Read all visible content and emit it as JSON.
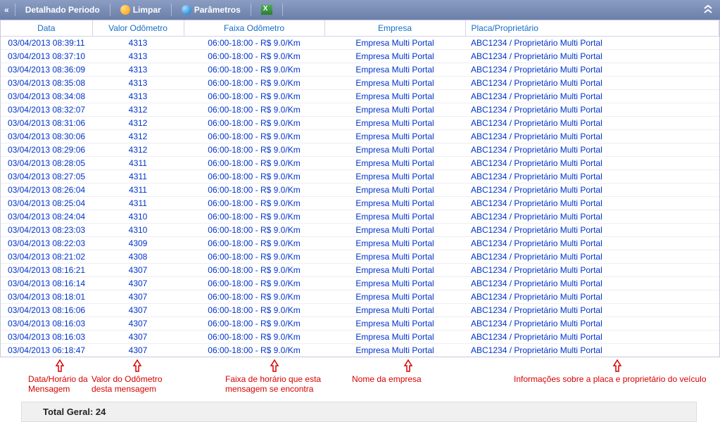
{
  "toolbar": {
    "detalhado": "Detalhado Periodo",
    "limpar": "Limpar",
    "parametros": "Parâmetros"
  },
  "columns": {
    "data": "Data",
    "valor": "Valor Odômetro",
    "faixa": "Faixa Odômetro",
    "empresa": "Empresa",
    "placa": "Placa/Proprietário"
  },
  "rows": [
    {
      "data": "03/04/2013 08:39:11",
      "valor": "4313",
      "faixa": "06:00-18:00 - R$ 9.0/Km",
      "empresa": "Empresa Multi Portal",
      "placa": "ABC1234 / Proprietário Multi Portal"
    },
    {
      "data": "03/04/2013 08:37:10",
      "valor": "4313",
      "faixa": "06:00-18:00 - R$ 9.0/Km",
      "empresa": "Empresa Multi Portal",
      "placa": "ABC1234 / Proprietário Multi Portal"
    },
    {
      "data": "03/04/2013 08:36:09",
      "valor": "4313",
      "faixa": "06:00-18:00 - R$ 9.0/Km",
      "empresa": "Empresa Multi Portal",
      "placa": "ABC1234 / Proprietário Multi Portal"
    },
    {
      "data": "03/04/2013 08:35:08",
      "valor": "4313",
      "faixa": "06:00-18:00 - R$ 9.0/Km",
      "empresa": "Empresa Multi Portal",
      "placa": "ABC1234 / Proprietário Multi Portal"
    },
    {
      "data": "03/04/2013 08:34:08",
      "valor": "4313",
      "faixa": "06:00-18:00 - R$ 9.0/Km",
      "empresa": "Empresa Multi Portal",
      "placa": "ABC1234 / Proprietário Multi Portal"
    },
    {
      "data": "03/04/2013 08:32:07",
      "valor": "4312",
      "faixa": "06:00-18:00 - R$ 9.0/Km",
      "empresa": "Empresa Multi Portal",
      "placa": "ABC1234 / Proprietário Multi Portal"
    },
    {
      "data": "03/04/2013 08:31:06",
      "valor": "4312",
      "faixa": "06:00-18:00 - R$ 9.0/Km",
      "empresa": "Empresa Multi Portal",
      "placa": "ABC1234 / Proprietário Multi Portal"
    },
    {
      "data": "03/04/2013 08:30:06",
      "valor": "4312",
      "faixa": "06:00-18:00 - R$ 9.0/Km",
      "empresa": "Empresa Multi Portal",
      "placa": "ABC1234 / Proprietário Multi Portal"
    },
    {
      "data": "03/04/2013 08:29:06",
      "valor": "4312",
      "faixa": "06:00-18:00 - R$ 9.0/Km",
      "empresa": "Empresa Multi Portal",
      "placa": "ABC1234 / Proprietário Multi Portal"
    },
    {
      "data": "03/04/2013 08:28:05",
      "valor": "4311",
      "faixa": "06:00-18:00 - R$ 9.0/Km",
      "empresa": "Empresa Multi Portal",
      "placa": "ABC1234 / Proprietário Multi Portal"
    },
    {
      "data": "03/04/2013 08:27:05",
      "valor": "4311",
      "faixa": "06:00-18:00 - R$ 9.0/Km",
      "empresa": "Empresa Multi Portal",
      "placa": "ABC1234 / Proprietário Multi Portal"
    },
    {
      "data": "03/04/2013 08:26:04",
      "valor": "4311",
      "faixa": "06:00-18:00 - R$ 9.0/Km",
      "empresa": "Empresa Multi Portal",
      "placa": "ABC1234 / Proprietário Multi Portal"
    },
    {
      "data": "03/04/2013 08:25:04",
      "valor": "4311",
      "faixa": "06:00-18:00 - R$ 9.0/Km",
      "empresa": "Empresa Multi Portal",
      "placa": "ABC1234 / Proprietário Multi Portal"
    },
    {
      "data": "03/04/2013 08:24:04",
      "valor": "4310",
      "faixa": "06:00-18:00 - R$ 9.0/Km",
      "empresa": "Empresa Multi Portal",
      "placa": "ABC1234 / Proprietário Multi Portal"
    },
    {
      "data": "03/04/2013 08:23:03",
      "valor": "4310",
      "faixa": "06:00-18:00 - R$ 9.0/Km",
      "empresa": "Empresa Multi Portal",
      "placa": "ABC1234 / Proprietário Multi Portal"
    },
    {
      "data": "03/04/2013 08:22:03",
      "valor": "4309",
      "faixa": "06:00-18:00 - R$ 9.0/Km",
      "empresa": "Empresa Multi Portal",
      "placa": "ABC1234 / Proprietário Multi Portal"
    },
    {
      "data": "03/04/2013 08:21:02",
      "valor": "4308",
      "faixa": "06:00-18:00 - R$ 9.0/Km",
      "empresa": "Empresa Multi Portal",
      "placa": "ABC1234 / Proprietário Multi Portal"
    },
    {
      "data": "03/04/2013 08:16:21",
      "valor": "4307",
      "faixa": "06:00-18:00 - R$ 9.0/Km",
      "empresa": "Empresa Multi Portal",
      "placa": "ABC1234 / Proprietário Multi Portal"
    },
    {
      "data": "03/04/2013 08:16:14",
      "valor": "4307",
      "faixa": "06:00-18:00 - R$ 9.0/Km",
      "empresa": "Empresa Multi Portal",
      "placa": "ABC1234 / Proprietário Multi Portal"
    },
    {
      "data": "03/04/2013 08:18:01",
      "valor": "4307",
      "faixa": "06:00-18:00 - R$ 9.0/Km",
      "empresa": "Empresa Multi Portal",
      "placa": "ABC1234 / Proprietário Multi Portal"
    },
    {
      "data": "03/04/2013 08:16:06",
      "valor": "4307",
      "faixa": "06:00-18:00 - R$ 9.0/Km",
      "empresa": "Empresa Multi Portal",
      "placa": "ABC1234 / Proprietário Multi Portal"
    },
    {
      "data": "03/04/2013 08:16:03",
      "valor": "4307",
      "faixa": "06:00-18:00 - R$ 9.0/Km",
      "empresa": "Empresa Multi Portal",
      "placa": "ABC1234 / Proprietário Multi Portal"
    },
    {
      "data": "03/04/2013 08:16:03",
      "valor": "4307",
      "faixa": "06:00-18:00 - R$ 9.0/Km",
      "empresa": "Empresa Multi Portal",
      "placa": "ABC1234 / Proprietário Multi Portal"
    },
    {
      "data": "03/04/2013 06:18:47",
      "valor": "4307",
      "faixa": "06:00-18:00 - R$ 9.0/Km",
      "empresa": "Empresa Multi Portal",
      "placa": "ABC1234 / Proprietário Multi Portal"
    }
  ],
  "annotations": {
    "a1": "Data/Horário da Mensagem",
    "a2": "Valor do Odômetro desta mensagem",
    "a3": "Faixa de horário que esta mensagem se encontra",
    "a4": "Nome da empresa",
    "a5": "Informações sobre a placa e proprietário do veículo"
  },
  "footer": {
    "total": "Total Geral: 24"
  }
}
